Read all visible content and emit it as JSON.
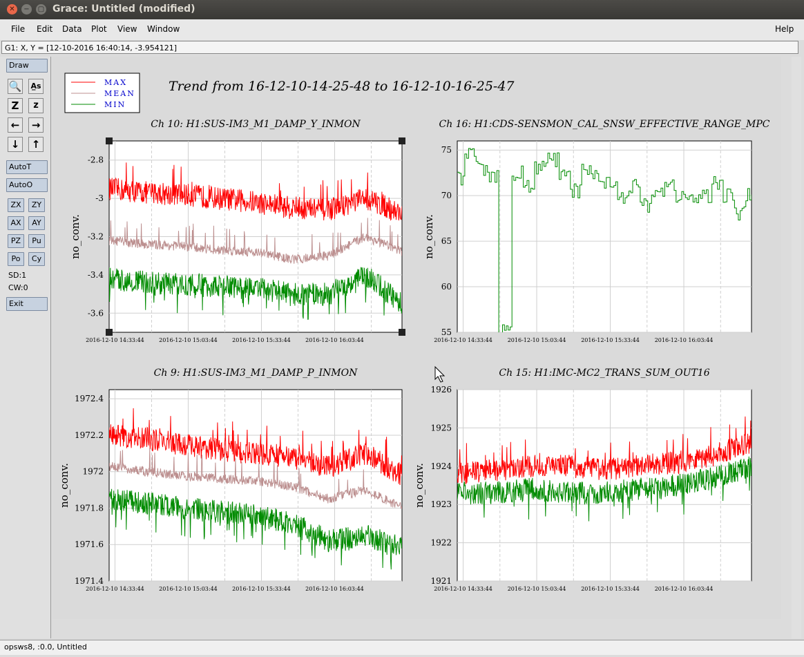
{
  "window": {
    "title": "Grace: Untitled (modified)"
  },
  "menu": {
    "file": "File",
    "edit": "Edit",
    "data": "Data",
    "plot": "Plot",
    "view": "View",
    "window": "Window",
    "help": "Help"
  },
  "locator": "G1: X, Y = [12-10-2016 16:40:14, -3.954121]",
  "toolbar": {
    "draw": "Draw",
    "autot": "AutoT",
    "autoo": "AutoO",
    "zx": "ZX",
    "zy": "ZY",
    "ax": "AX",
    "ay": "AY",
    "pz": "PZ",
    "pu": "Pu",
    "po": "Po",
    "cy": "Cy",
    "sd": "SD:1",
    "cw": "CW:0",
    "exit": "Exit"
  },
  "statusbar": "opsws8, :0.0, Untitled",
  "plot": {
    "title": "Trend from 16-12-10-14-25-48 to 16-12-10-16-25-47",
    "legend": [
      "MAX",
      "MEAN",
      "MIN"
    ],
    "colors": {
      "max": "#ff0000",
      "mean": "#bc8f8f",
      "min": "#008b00"
    },
    "xticks": [
      "2016-12-10 14:33:44",
      "2016-12-10 15:03:44",
      "2016-12-10 15:33:44",
      "2016-12-10 16:03:44"
    ]
  },
  "chart_data": [
    {
      "type": "line",
      "title": "Ch 10: H1:SUS-IM3_M1_DAMP_Y_INMON",
      "ylabel": "no_conv.",
      "ylim": [
        -3.7,
        -2.7
      ],
      "yticks": [
        "-2.8",
        "-3",
        "-3.2",
        "-3.4",
        "-3.6"
      ],
      "yvals": [
        -2.8,
        -3.0,
        -3.2,
        -3.4,
        -3.6
      ],
      "series": [
        {
          "name": "MAX",
          "values": [
            -2.95,
            -2.97,
            -2.98,
            -3.0,
            -3.02,
            -3.05,
            -3.06,
            -3.0,
            -3.08
          ]
        },
        {
          "name": "MEAN",
          "values": [
            -3.22,
            -3.24,
            -3.25,
            -3.27,
            -3.28,
            -3.32,
            -3.3,
            -3.2,
            -3.28
          ]
        },
        {
          "name": "MIN",
          "values": [
            -3.42,
            -3.44,
            -3.45,
            -3.46,
            -3.47,
            -3.5,
            -3.5,
            -3.4,
            -3.55
          ]
        }
      ]
    },
    {
      "type": "line",
      "title": "Ch 16: H1:CDS-SENSMON_CAL_SNSW_EFFECTIVE_RANGE_MPC",
      "ylabel": "no_conv.",
      "ylim": [
        55,
        76
      ],
      "yticks": [
        "75",
        "70",
        "65",
        "60",
        "55"
      ],
      "yvals": [
        75,
        70,
        65,
        60,
        55
      ],
      "series": [
        {
          "name": "MIN",
          "values": [
            72,
            74.5,
            73,
            72,
            55,
            72.5,
            71,
            73,
            74,
            72,
            70.5,
            73,
            72,
            71.5,
            70,
            71,
            69,
            70.5,
            71,
            70,
            69.5,
            70,
            71.5,
            70,
            68,
            70
          ]
        }
      ]
    },
    {
      "type": "line",
      "title": "Ch 9: H1:SUS-IM3_M1_DAMP_P_INMON",
      "ylabel": "no_conv.",
      "ylim": [
        1971.4,
        1972.45
      ],
      "yticks": [
        "1972.4",
        "1972.2",
        "1972",
        "1971.8",
        "1971.6",
        "1971.4"
      ],
      "yvals": [
        1972.4,
        1972.2,
        1972.0,
        1971.8,
        1971.6,
        1971.4
      ],
      "series": [
        {
          "name": "MAX",
          "values": [
            1972.2,
            1972.18,
            1972.15,
            1972.12,
            1972.1,
            1972.08,
            1972.02,
            1972.1,
            1971.98
          ]
        },
        {
          "name": "MEAN",
          "values": [
            1972.03,
            1972.0,
            1971.98,
            1971.96,
            1971.95,
            1971.92,
            1971.85,
            1971.9,
            1971.8
          ]
        },
        {
          "name": "MIN",
          "values": [
            1971.85,
            1971.83,
            1971.8,
            1971.78,
            1971.76,
            1971.72,
            1971.62,
            1971.65,
            1971.58
          ]
        }
      ]
    },
    {
      "type": "line",
      "title": "Ch 15: H1:IMC-MC2_TRANS_SUM_OUT16",
      "ylabel": "no_conv.",
      "ylim": [
        1921,
        1926
      ],
      "yticks": [
        "1926",
        "1925",
        "1924",
        "1923",
        "1922",
        "1921"
      ],
      "yvals": [
        1926,
        1925,
        1924,
        1923,
        1922,
        1921
      ],
      "series": [
        {
          "name": "MAX",
          "values": [
            1923.8,
            1923.9,
            1924.0,
            1924.0,
            1923.9,
            1924.0,
            1924.1,
            1924.3,
            1924.6
          ]
        },
        {
          "name": "MIN",
          "values": [
            1923.3,
            1923.3,
            1923.4,
            1923.3,
            1923.3,
            1923.4,
            1923.5,
            1923.7,
            1924.0
          ]
        }
      ]
    }
  ]
}
